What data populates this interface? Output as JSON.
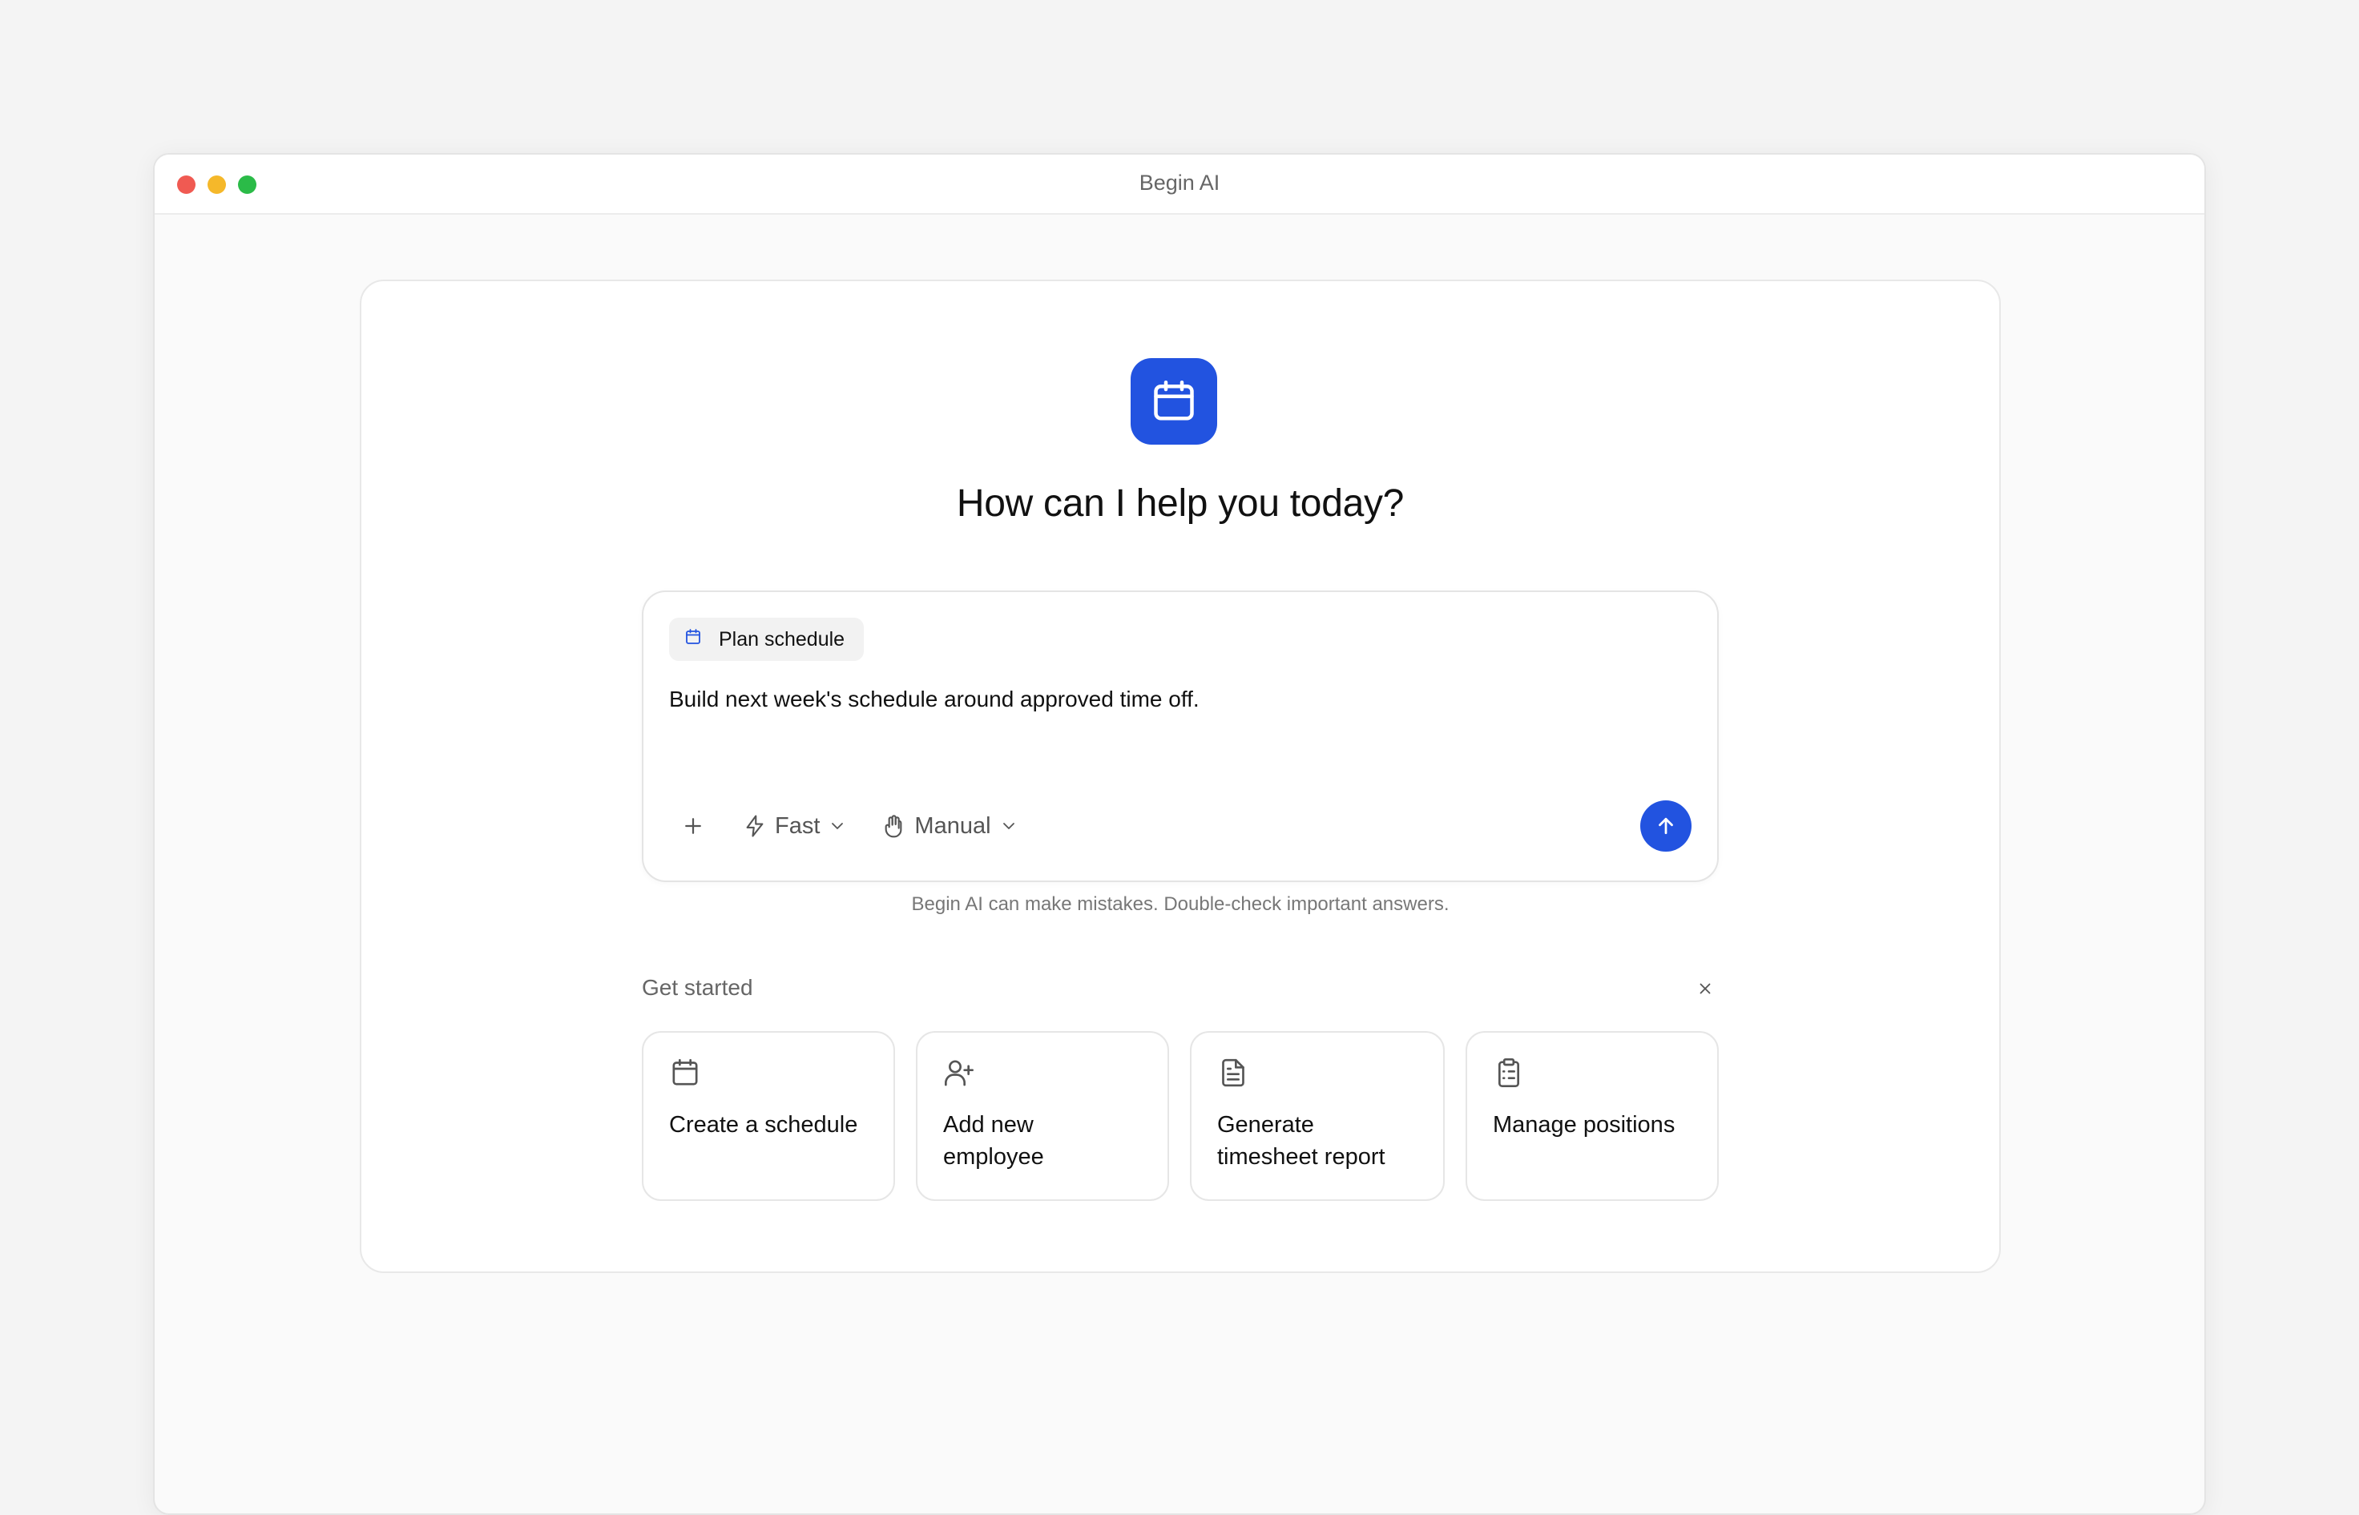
{
  "window": {
    "title": "Begin AI"
  },
  "hero": {
    "icon": "calendar-icon",
    "title": "How can I help you today?"
  },
  "composer": {
    "chip": {
      "icon": "calendar-icon",
      "label": "Plan schedule"
    },
    "text": "Build next week's schedule around approved time off.",
    "add_icon": "plus-icon",
    "speed": {
      "icon": "lightning-icon",
      "label": "Fast"
    },
    "mode": {
      "icon": "hand-icon",
      "label": "Manual"
    },
    "send_icon": "arrow-up-icon"
  },
  "disclaimer": "Begin AI can make mistakes. Double-check important answers.",
  "get_started": {
    "label": "Get started",
    "cards": [
      {
        "icon": "calendar-icon",
        "label": "Create a schedule"
      },
      {
        "icon": "user-plus-icon",
        "label": "Add new employee"
      },
      {
        "icon": "document-icon",
        "label": "Generate timesheet report"
      },
      {
        "icon": "clipboard-icon",
        "label": "Manage positions"
      }
    ]
  },
  "colors": {
    "accent": "#2253e0",
    "traffic_red": "#f05a52",
    "traffic_yellow": "#f5b82a",
    "traffic_green": "#2bbb48"
  }
}
